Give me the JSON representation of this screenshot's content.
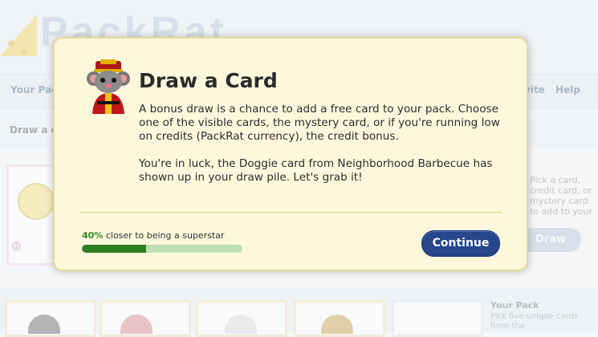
{
  "background": {
    "logo_text": "PackRat",
    "nav": [
      {
        "label": "Your Pack"
      },
      {
        "label": "Invite"
      },
      {
        "label": "Help"
      }
    ],
    "sub_nav_label": "Draw a card",
    "right_panel_text": "Pick a card, credit card, or mystery card to add to your",
    "draw_button": "Draw",
    "your_pack_title": "Your Pack",
    "your_pack_desc": "Pick five unique cards from the"
  },
  "modal": {
    "title": "Draw a Card",
    "paragraph1": "A bonus draw is a chance to add a free card to your pack. Choose one of the visible cards, the mystery card, or if you're running low on credits (PackRat currency), the credit bonus.",
    "paragraph2": "You're in luck, the Doggie card from Neighborhood Barbecue has shown up in your draw pile. Let's grab it!",
    "progress_percent_text": "40%",
    "progress_suffix": "closer to being a superstar",
    "progress_value": 0.4,
    "continue_label": "Continue",
    "icon": "rat-emperor-icon"
  }
}
